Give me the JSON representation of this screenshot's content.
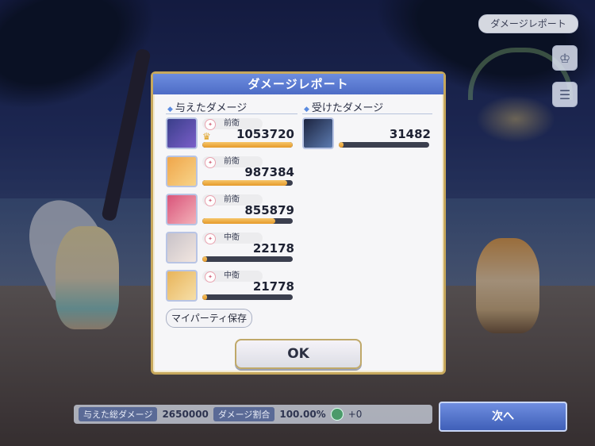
{
  "top_button": "ダメージレポート",
  "dialog": {
    "title": "ダメージレポート",
    "dealt_title": "与えたダメージ",
    "received_title": "受けたダメージ",
    "dealt": [
      {
        "position": "前衛",
        "damage": "1053720",
        "bar": 1.0,
        "top": true,
        "portrait_colors": [
          "#3a3f8a",
          "#7a5ec9"
        ]
      },
      {
        "position": "前衛",
        "damage": "987384",
        "bar": 0.94,
        "top": false,
        "portrait_colors": [
          "#f0a64a",
          "#f7d48a"
        ]
      },
      {
        "position": "前衛",
        "damage": "855879",
        "bar": 0.81,
        "top": false,
        "portrait_colors": [
          "#d9547a",
          "#f3b0b8"
        ]
      },
      {
        "position": "中衛",
        "damage": "22178",
        "bar": 0.03,
        "top": false,
        "portrait_colors": [
          "#c8c2c8",
          "#f2e6e0"
        ]
      },
      {
        "position": "中衛",
        "damage": "21778",
        "bar": 0.03,
        "top": false,
        "portrait_colors": [
          "#e8b45a",
          "#f6dfa8"
        ]
      }
    ],
    "received": [
      {
        "damage": "31482",
        "bar": 0.03,
        "portrait_colors": [
          "#1c2440",
          "#5c7bb0"
        ]
      }
    ],
    "save_button": "マイパーティ保存",
    "ok_button": "OK"
  },
  "bottom": {
    "total_label": "与えた総ダメージ",
    "total_value": "2650000",
    "ratio_label": "ダメージ割合",
    "ratio_value": "100.00%",
    "bonus": "+0"
  },
  "next_button": "次へ"
}
